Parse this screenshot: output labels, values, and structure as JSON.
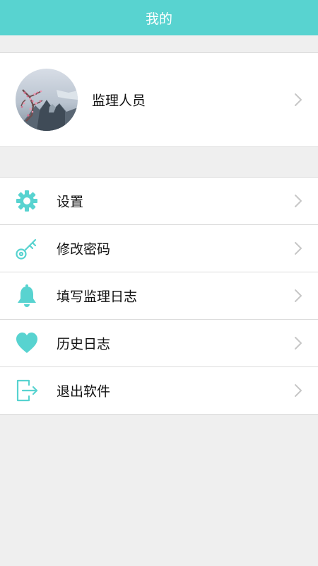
{
  "header": {
    "title": "我的"
  },
  "profile": {
    "name": "监理人员"
  },
  "menu": {
    "items": [
      {
        "label": "设置",
        "icon": "gear-icon"
      },
      {
        "label": "修改密码",
        "icon": "key-icon"
      },
      {
        "label": "填写监理日志",
        "icon": "bell-icon"
      },
      {
        "label": "历史日志",
        "icon": "heart-icon"
      },
      {
        "label": "退出软件",
        "icon": "exit-icon"
      }
    ]
  },
  "colors": {
    "accent": "#58d3d0",
    "background": "#efefef",
    "chevron": "#c7c7c7"
  }
}
